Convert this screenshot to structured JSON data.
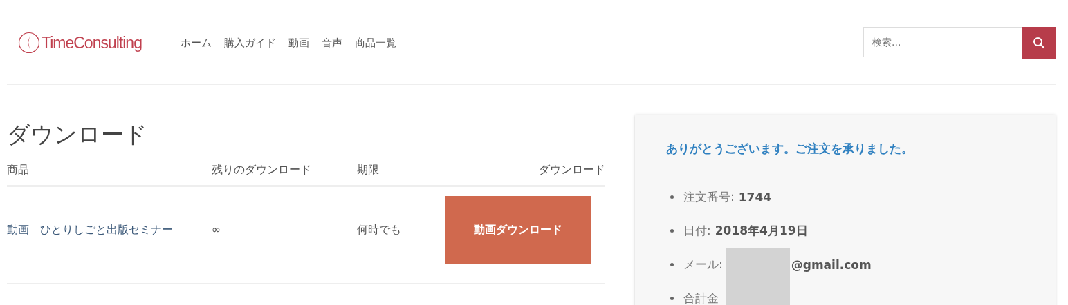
{
  "header": {
    "logo": "TimeConsulting",
    "nav": [
      {
        "label": "ホーム"
      },
      {
        "label": "購入ガイド"
      },
      {
        "label": "動画"
      },
      {
        "label": "音声"
      },
      {
        "label": "商品一覧"
      }
    ],
    "search": {
      "placeholder": "検索..."
    }
  },
  "downloads": {
    "title": "ダウンロード",
    "columns": [
      "商品",
      "残りのダウンロード",
      "期限",
      "ダウンロード"
    ],
    "rows": [
      {
        "product": "動画　ひとりしごと出版セミナー",
        "remaining": "∞",
        "expires": "何時でも",
        "button": "動画ダウンロード"
      }
    ]
  },
  "order": {
    "message": "ありがとうございます。ご注文を承りました。",
    "details": [
      {
        "label": "注文番号:",
        "value": "1744"
      },
      {
        "label": "日付:",
        "value": "2018年4月19日"
      },
      {
        "label": "メール:",
        "value": "@gmail.com",
        "redacted": true
      },
      {
        "label": "合計金"
      }
    ]
  }
}
